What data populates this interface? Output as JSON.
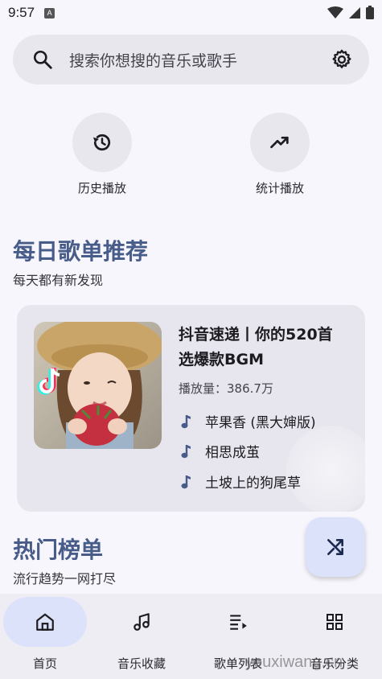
{
  "status_bar": {
    "time": "9:57",
    "badge": "A"
  },
  "search": {
    "placeholder": "搜索你想搜的音乐或歌手"
  },
  "quick_actions": [
    {
      "label": "历史播放",
      "icon": "history-icon"
    },
    {
      "label": "统计播放",
      "icon": "trending-up-icon"
    }
  ],
  "daily": {
    "title": "每日歌单推荐",
    "subtitle": "每天都有新发现",
    "card": {
      "title_line1": "抖音速递丨你的520首",
      "title_line2": "选爆款BGM",
      "play_count": "播放量：386.7万",
      "songs": [
        "苹果香 (黑大婶版)",
        "相思成茧",
        "土坡上的狗尾草"
      ]
    }
  },
  "charts": {
    "title": "热门榜单",
    "subtitle": "流行趋势一网打尽"
  },
  "bottom_nav": [
    {
      "label": "首页",
      "icon": "home-icon",
      "active": true
    },
    {
      "label": "音乐收藏",
      "icon": "music-note-icon",
      "active": false
    },
    {
      "label": "歌单列表",
      "icon": "playlist-icon",
      "active": false
    },
    {
      "label": "音乐分类",
      "icon": "grid-icon",
      "active": false
    }
  ],
  "watermark": "youxiwang.cn",
  "colors": {
    "accent": "#485c8a",
    "surface": "#e8e7ee",
    "nav_active": "#dde2fb"
  }
}
